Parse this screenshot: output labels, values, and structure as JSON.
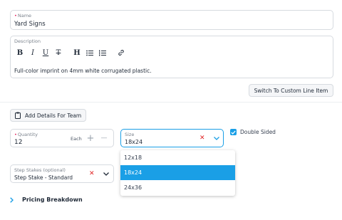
{
  "name_field": {
    "label": "Name",
    "value": "Yard Signs"
  },
  "description": {
    "label": "Description",
    "toolbar": {
      "bold": "B",
      "italic": "I",
      "underline": "U",
      "strike": "T",
      "heading": "H"
    },
    "value": "Full-color imprint on 4mm white corrugated plastic."
  },
  "switch_button": "Switch To Custom Line Item",
  "team_button": "Add Details For Team",
  "quantity": {
    "label": "Quantity",
    "value": "12",
    "unit": "Each",
    "plus": "+",
    "minus": "—"
  },
  "size": {
    "label": "Size",
    "value": "18x24",
    "options": [
      "12x18",
      "18x24",
      "24x36"
    ],
    "selected_index": 1
  },
  "double_sided": {
    "label": "Double Sided",
    "checked": true
  },
  "step_stakes": {
    "label": "Step Stakes (optional)",
    "value": "Step Stake - Standard"
  },
  "pricing": {
    "label": "Pricing Breakdown"
  },
  "colors": {
    "accent": "#1a9fe6",
    "danger": "#e02424",
    "required": "#e0245e"
  }
}
